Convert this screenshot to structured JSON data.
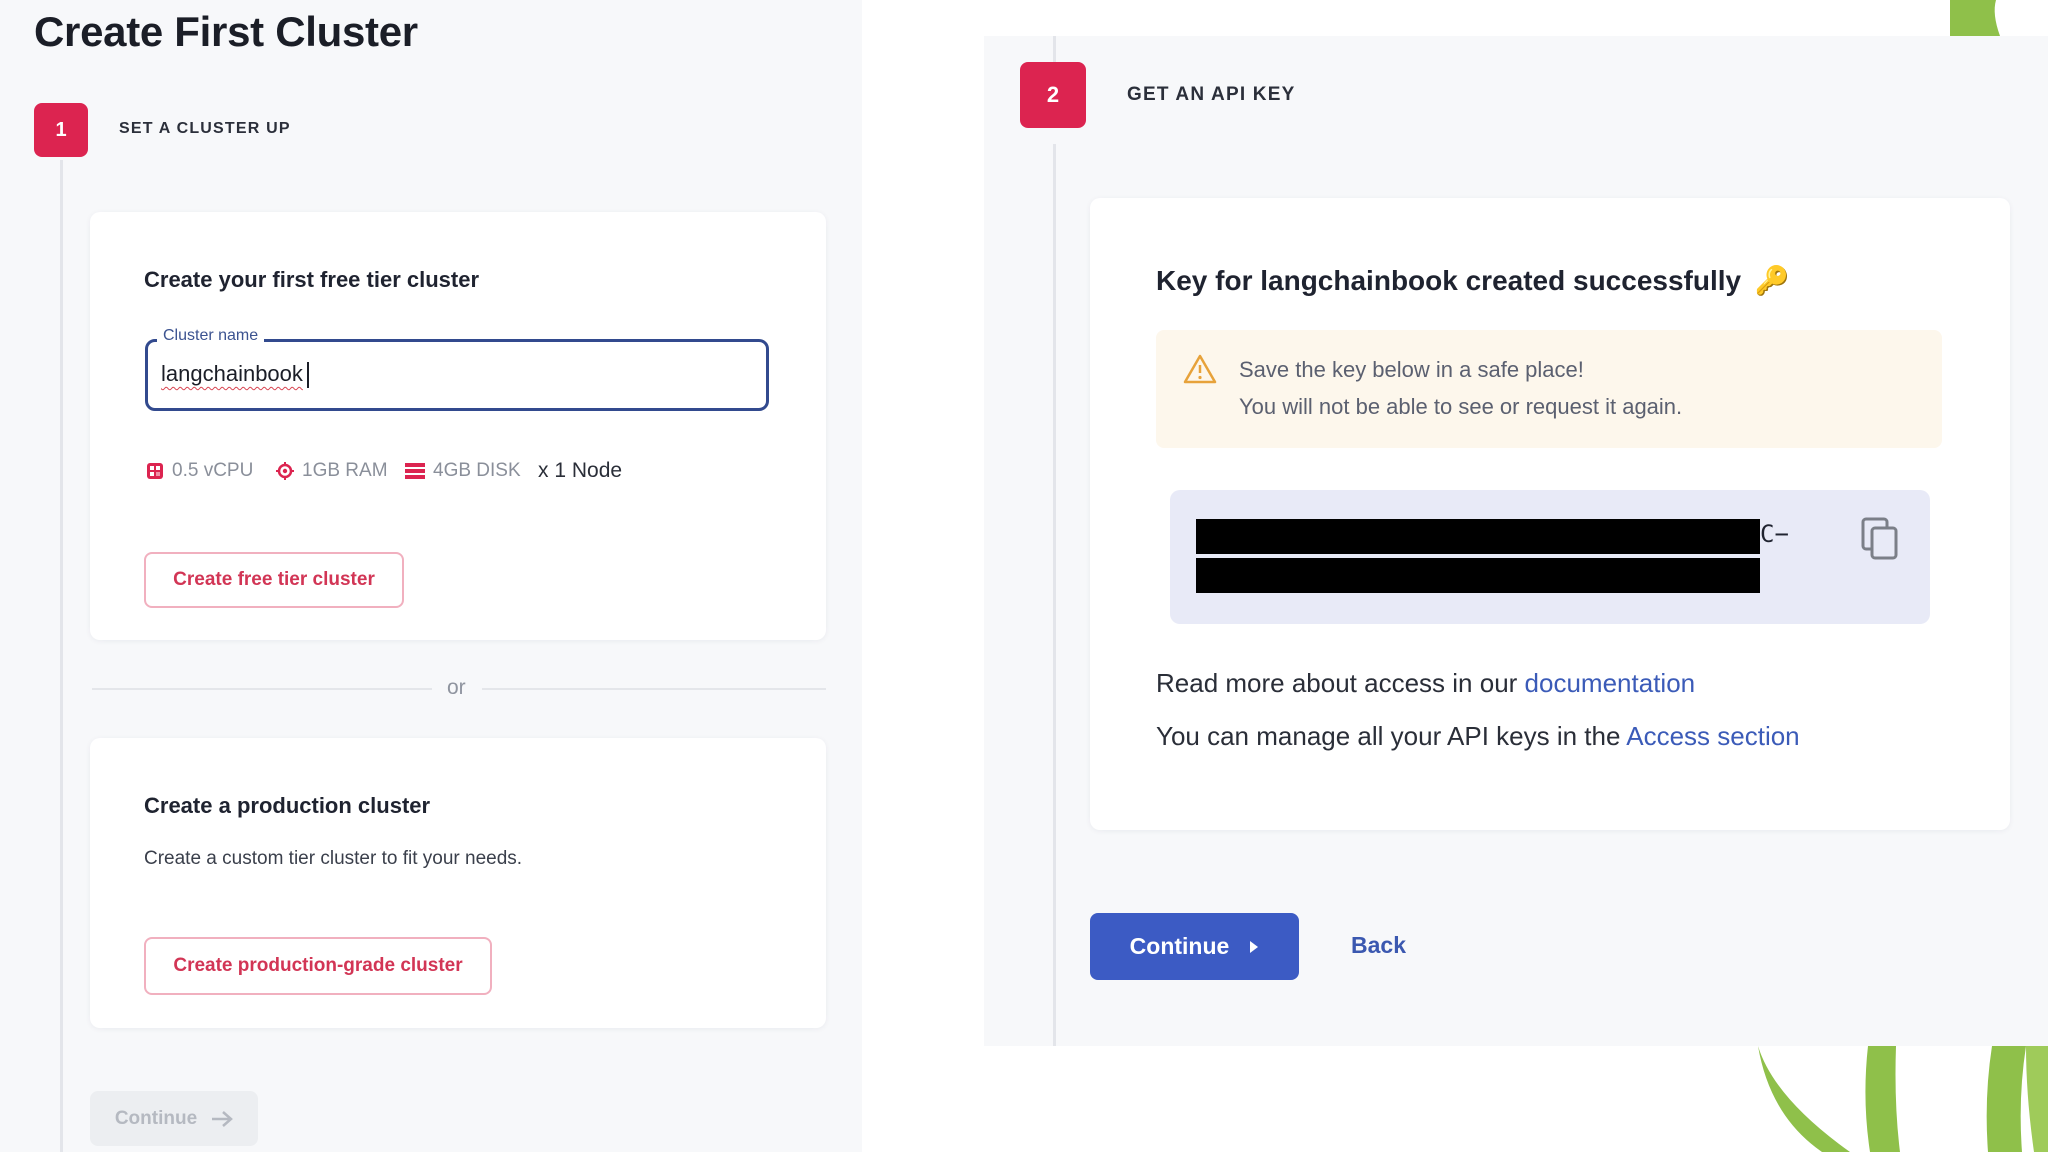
{
  "page": {
    "title": "Create First Cluster"
  },
  "step1": {
    "number": "1",
    "title": "SET A CLUSTER UP",
    "free_card": {
      "heading": "Create your first free tier cluster",
      "field_label": "Cluster name",
      "field_value": "langchainbook",
      "specs": [
        {
          "icon": "cpu-icon",
          "label": "0.5 vCPU"
        },
        {
          "icon": "memory-chip-icon",
          "label": "1GB RAM"
        },
        {
          "icon": "disk-icon",
          "label": "4GB DISK"
        }
      ],
      "node_count": "x 1 Node",
      "button_label": "Create free tier cluster"
    },
    "or_label": "or",
    "prod_card": {
      "heading": "Create a production cluster",
      "description": "Create a custom tier cluster to fit your needs.",
      "button_label": "Create production-grade cluster"
    },
    "continue_label": "Continue"
  },
  "step2": {
    "number": "2",
    "title": "GET AN API KEY",
    "heading": "Key for langchainbook created successfully",
    "heading_emoji": "🔑",
    "warning_line1": "Save the key below in a safe place!",
    "warning_line2": "You will not be able to see or request it again.",
    "key_visible_suffix": "C−",
    "info_line1_text": "Read more about access in our ",
    "info_line1_link": "documentation",
    "info_line2_text": "You can manage all your API keys in the ",
    "info_line2_link": "Access section",
    "continue_label": "Continue",
    "back_label": "Back"
  },
  "colors": {
    "step_badge": "#dc2450",
    "primary": "#3c5bc4",
    "link": "#3b5bb8",
    "outline_button_text": "#d23555",
    "warning_bg": "#fdf7ec",
    "warning_icon": "#e7a23a",
    "key_box_bg": "#e8eaf7",
    "leaf_green": "#8fc04a"
  }
}
